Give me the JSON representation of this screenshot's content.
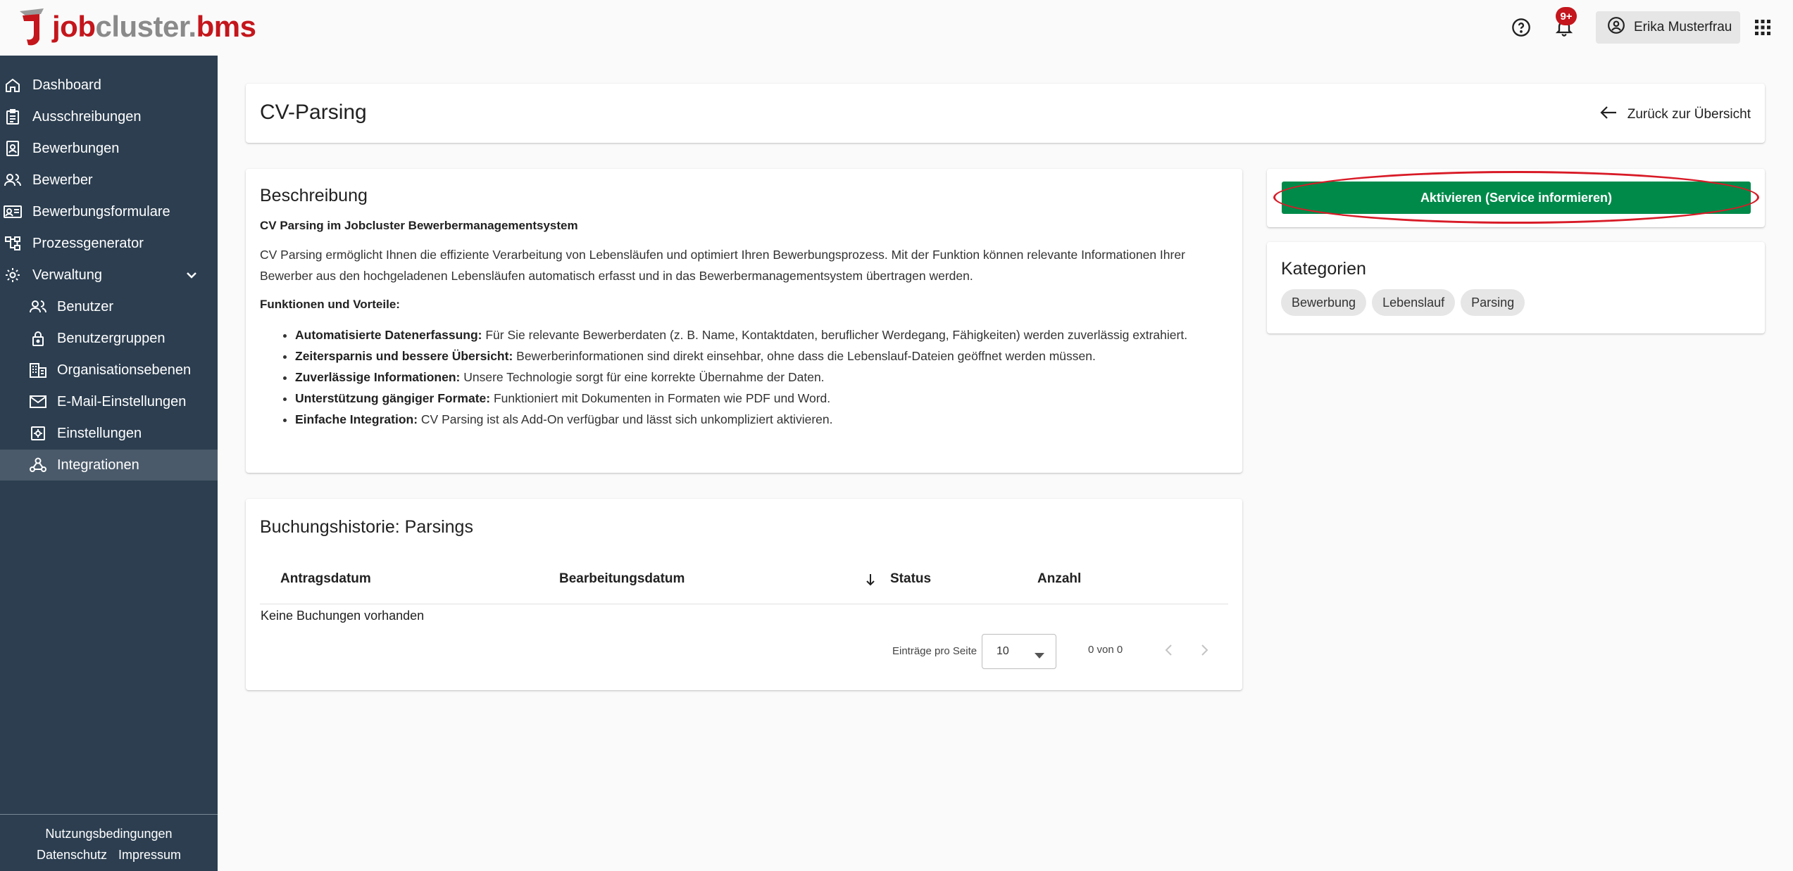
{
  "header": {
    "logo": {
      "job": "job",
      "cluster": "cluster",
      "dot": ".",
      "bms": "bms"
    },
    "notification_badge": "9+",
    "user_name": "Erika Musterfrau"
  },
  "sidebar": {
    "items": [
      {
        "label": "Dashboard",
        "icon": "home-icon"
      },
      {
        "label": "Ausschreibungen",
        "icon": "clipboard-icon"
      },
      {
        "label": "Bewerbungen",
        "icon": "document-person-icon"
      },
      {
        "label": "Bewerber",
        "icon": "people-icon"
      },
      {
        "label": "Bewerbungsformulare",
        "icon": "contact-card-icon"
      },
      {
        "label": "Prozessgenerator",
        "icon": "flowchart-icon"
      },
      {
        "label": "Verwaltung",
        "icon": "gear-icon"
      },
      {
        "label": "Benutzer",
        "icon": "people-icon"
      },
      {
        "label": "Benutzergruppen",
        "icon": "lock-icon"
      },
      {
        "label": "Organisationsebenen",
        "icon": "building-icon"
      },
      {
        "label": "E-Mail-Einstellungen",
        "icon": "mail-icon"
      },
      {
        "label": "Einstellungen",
        "icon": "settings-box-icon"
      },
      {
        "label": "Integrationen",
        "icon": "webhook-icon"
      }
    ],
    "footer": {
      "terms": "Nutzungsbedingungen",
      "privacy": "Datenschutz",
      "imprint": "Impressum"
    }
  },
  "page": {
    "title": "CV-Parsing",
    "back_label": "Zurück zur Übersicht"
  },
  "description": {
    "heading": "Beschreibung",
    "subheading": "CV Parsing im Jobcluster Bewerbermanagementsystem",
    "intro": "CV Parsing ermöglicht Ihnen die effiziente Verarbeitung von Lebensläufen und optimiert Ihren Bewerbungsprozess. Mit der Funktion können relevante Informationen Ihrer Bewerber aus den hochgeladenen Lebensläufen automatisch erfasst und in das Bewerbermanagementsystem übertragen werden.",
    "features_heading": "Funktionen und Vorteile:",
    "features": [
      {
        "title": "Automatisierte Datenerfassung:",
        "text": " Für Sie relevante Bewerberdaten (z. B. Name, Kontaktdaten, beruflicher Werdegang, Fähigkeiten) werden zuverlässig extrahiert."
      },
      {
        "title": "Zeitersparnis und bessere Übersicht:",
        "text": " Bewerberinformationen sind direkt einsehbar, ohne dass die Lebenslauf-Dateien geöffnet werden müssen."
      },
      {
        "title": "Zuverlässige Informationen:",
        "text": " Unsere Technologie sorgt für eine korrekte Übernahme der Daten."
      },
      {
        "title": "Unterstützung gängiger Formate:",
        "text": " Funktioniert mit Dokumenten in Formaten wie PDF und Word."
      },
      {
        "title": "Einfache Integration:",
        "text": " CV Parsing ist als Add-On verfügbar und lässt sich unkompliziert aktivieren."
      }
    ]
  },
  "activate": {
    "label": "Aktivieren (Service informieren)",
    "color": "#008a4a",
    "highlight_color": "#d81b27"
  },
  "categories": {
    "heading": "Kategorien",
    "chips": [
      "Bewerbung",
      "Lebenslauf",
      "Parsing"
    ]
  },
  "history": {
    "heading": "Buchungshistorie: Parsings",
    "columns": [
      "Antragsdatum",
      "Bearbeitungsdatum",
      "Status",
      "Anzahl"
    ],
    "empty_text": "Keine Buchungen vorhanden",
    "per_page_label": "Einträge pro Seite",
    "per_page_value": "10",
    "range_text": "0 von 0"
  },
  "colors": {
    "sidebar_bg": "#2c3e50",
    "brand_red": "#c4161c"
  }
}
